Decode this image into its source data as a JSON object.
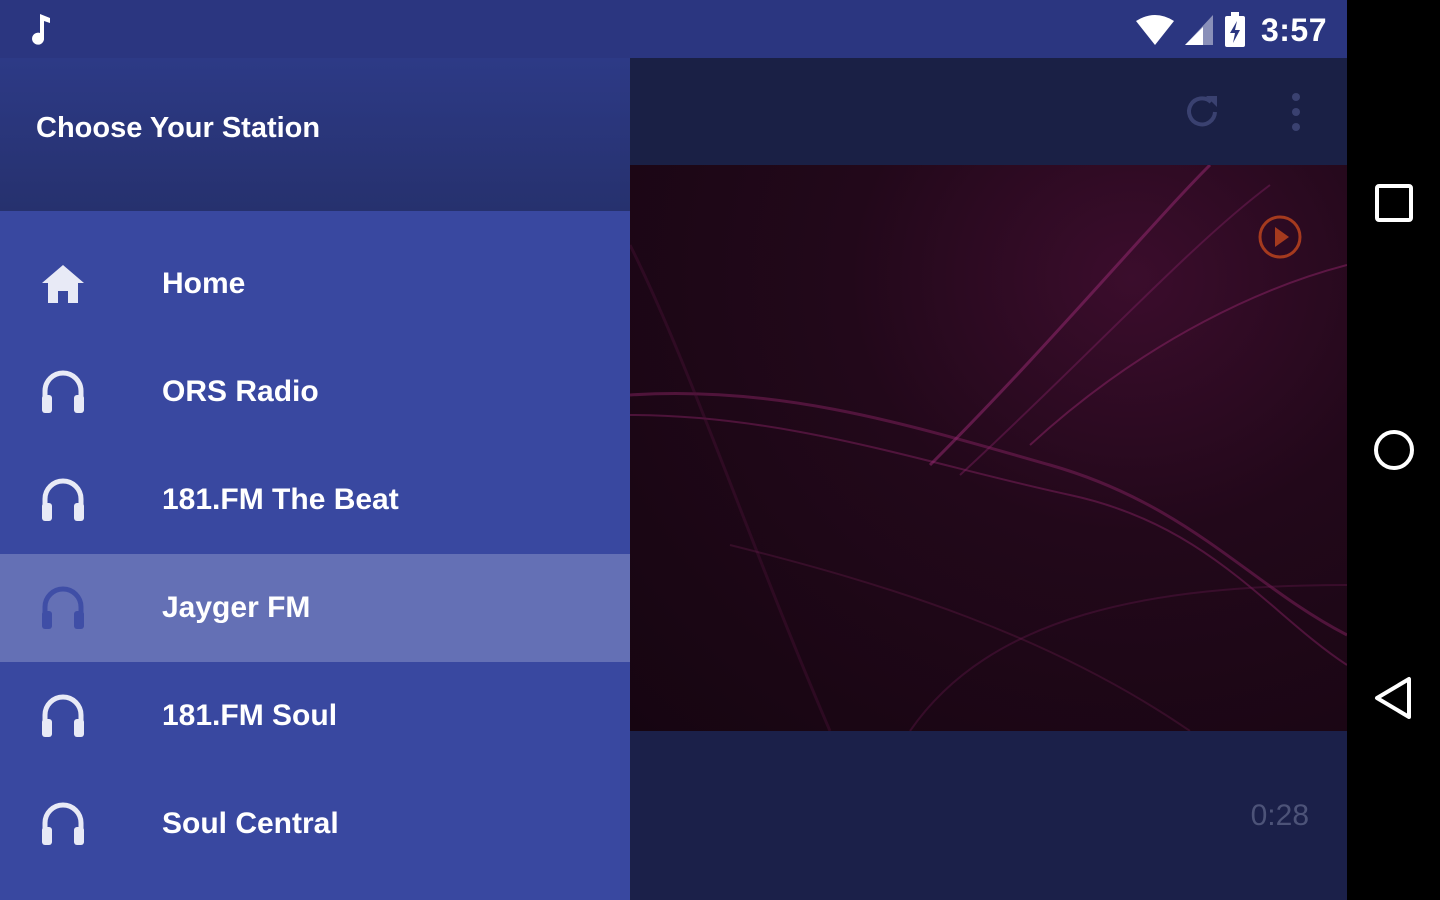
{
  "status_bar": {
    "time": "3:57",
    "icons": [
      "music-note-icon",
      "wifi-icon",
      "cell-signal-icon",
      "battery-charging-icon"
    ]
  },
  "drawer": {
    "title": "Choose Your Station",
    "items": [
      {
        "label": "Home",
        "icon": "home-icon",
        "active": false
      },
      {
        "label": "ORS Radio",
        "icon": "headphones-icon",
        "active": false
      },
      {
        "label": "181.FM The Beat",
        "icon": "headphones-icon",
        "active": false
      },
      {
        "label": "Jayger FM",
        "icon": "headphones-icon",
        "active": true
      },
      {
        "label": "181.FM Soul",
        "icon": "headphones-icon",
        "active": false
      },
      {
        "label": "Soul Central",
        "icon": "headphones-icon",
        "active": false
      }
    ]
  },
  "toolbar": {
    "icons": [
      "refresh-icon",
      "more-vert-icon"
    ]
  },
  "player": {
    "elapsed": "0:28",
    "play_icon": "play-circle-icon"
  },
  "nav_bar": {
    "icons": [
      "recents-square-icon",
      "home-circle-icon",
      "back-triangle-icon"
    ]
  },
  "colors": {
    "drawer_bg": "#3948a0",
    "drawer_active": "#6470b5",
    "status_bar": "#2b3680",
    "content_bg": "#1b2049",
    "play_accent": "#a53a1e"
  }
}
